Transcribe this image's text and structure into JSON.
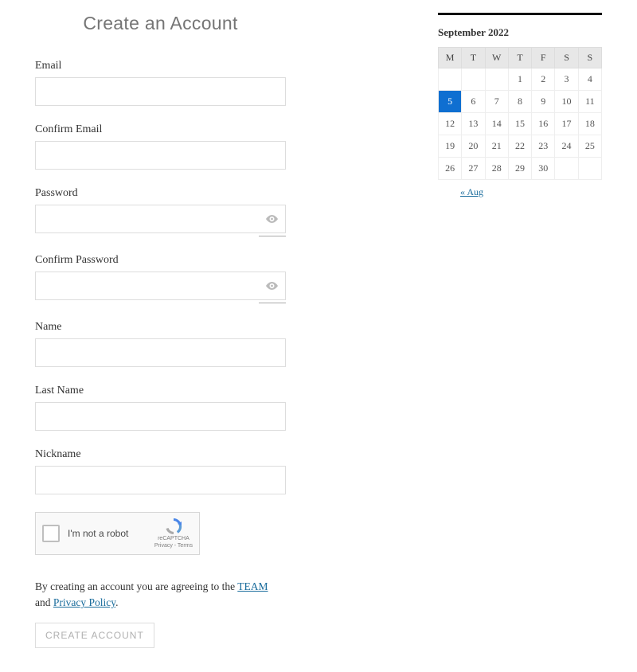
{
  "form": {
    "title": "Create an Account",
    "labels": {
      "email": "Email",
      "confirm_email": "Confirm Email",
      "password": "Password",
      "confirm_password": "Confirm Password",
      "name": "Name",
      "last_name": "Last Name",
      "nickname": "Nickname"
    },
    "values": {
      "email": "",
      "confirm_email": "",
      "password": "",
      "confirm_password": "",
      "name": "",
      "last_name": "",
      "nickname": ""
    },
    "captcha": {
      "label": "I'm not a robot",
      "brand": "reCAPTCHA",
      "terms": "Privacy - Terms"
    },
    "legal": {
      "prefix": "By creating an account you are agreeing to the ",
      "team_link": "TEAM",
      "middle": " and ",
      "privacy_link": "Privacy Policy",
      "suffix": "."
    },
    "submit_label": "CREATE ACCOUNT"
  },
  "calendar": {
    "month_label": "September 2022",
    "weekdays": [
      "M",
      "T",
      "W",
      "T",
      "F",
      "S",
      "S"
    ],
    "weeks": [
      [
        "",
        "",
        "",
        "1",
        "2",
        "3",
        "4"
      ],
      [
        "5",
        "6",
        "7",
        "8",
        "9",
        "10",
        "11"
      ],
      [
        "12",
        "13",
        "14",
        "15",
        "16",
        "17",
        "18"
      ],
      [
        "19",
        "20",
        "21",
        "22",
        "23",
        "24",
        "25"
      ],
      [
        "26",
        "27",
        "28",
        "29",
        "30",
        "",
        ""
      ]
    ],
    "today": "5",
    "prev_label": "« Aug"
  },
  "colors": {
    "link": "#1a6c9c",
    "today_bg": "#0f6fd1"
  }
}
